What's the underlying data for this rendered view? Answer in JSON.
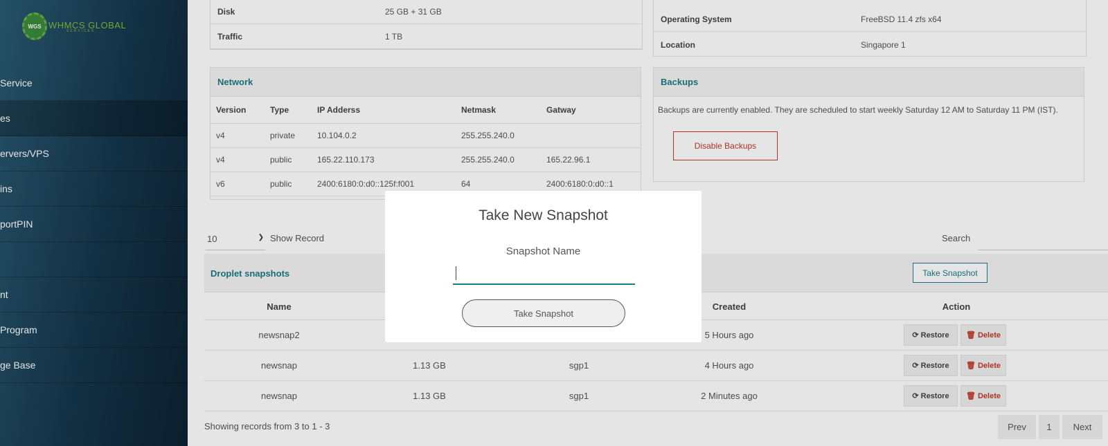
{
  "sidebar": {
    "logo_badge": "WGS",
    "logo_text": "WHMCS GLOBAL",
    "logo_sub": "SERVICES",
    "items": [
      {
        "label": "Service"
      },
      {
        "label": "es"
      },
      {
        "label": "ervers/VPS"
      },
      {
        "label": "ins"
      },
      {
        "label": "portPIN"
      },
      {
        "label": ""
      },
      {
        "label": "nt"
      },
      {
        "label": "Program"
      },
      {
        "label": "ge Base"
      }
    ]
  },
  "specs": {
    "disk_label": "Disk",
    "disk_value": "25 GB + 31 GB",
    "traffic_label": "Traffic",
    "traffic_value": "1 TB"
  },
  "system": {
    "os_label": "Operating System",
    "os_value": "FreeBSD 11.4 zfs x64",
    "location_label": "Location",
    "location_value": "Singapore 1"
  },
  "network": {
    "title": "Network",
    "columns": [
      "Version",
      "Type",
      "IP Adderss",
      "Netmask",
      "Gatway"
    ],
    "rows": [
      [
        "v4",
        "private",
        "10.104.0.2",
        "255.255.240.0",
        ""
      ],
      [
        "v4",
        "public",
        "165.22.110.173",
        "255.255.240.0",
        "165.22.96.1"
      ],
      [
        "v6",
        "public",
        "2400:6180:0:d0::125f:f001",
        "64",
        "2400:6180:0:d0::1"
      ]
    ]
  },
  "backups": {
    "title": "Backups",
    "text": "Backups are currently enabled. They are scheduled to start weekly Saturday 12 AM to Saturday 11 PM (IST).",
    "disable_label": "Disable Backups"
  },
  "controls": {
    "page_size": "10",
    "show_record": "Show Record",
    "search_label": "Search"
  },
  "snapshots": {
    "title": "Droplet snapshots",
    "take_label": "Take Snapshot",
    "columns": {
      "name": "Name",
      "created": "Created",
      "action": "Action"
    },
    "restore_label": "Restore",
    "delete_label": "Delete",
    "rows": [
      {
        "name": "newsnap2",
        "size": "",
        "region": "",
        "created": "5 Hours ago"
      },
      {
        "name": "newsnap",
        "size": "1.13 GB",
        "region": "sgp1",
        "created": "4 Hours ago"
      },
      {
        "name": "newsnap",
        "size": "1.13 GB",
        "region": "sgp1",
        "created": "2 Minutes ago"
      }
    ],
    "showing": "Showing records from 3 to 1 - 3",
    "prev": "Prev",
    "page": "1",
    "next": "Next"
  },
  "modal": {
    "title": "Take New Snapshot",
    "field_label": "Snapshot Name",
    "field_value": "",
    "submit_label": "Take Snapshot"
  }
}
